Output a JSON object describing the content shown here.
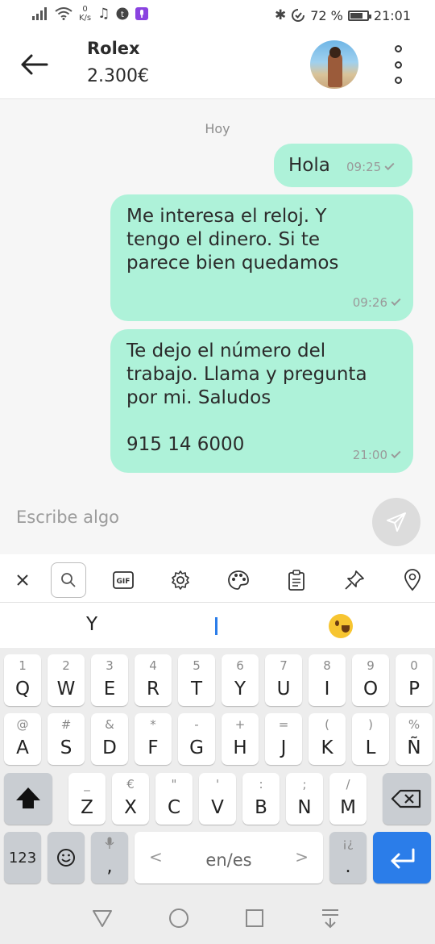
{
  "status_bar": {
    "speed_value": "0",
    "speed_unit": "K/s",
    "battery": "72 %",
    "time": "21:01"
  },
  "header": {
    "title": "Rolex",
    "price": "2.300€"
  },
  "chat": {
    "day_label": "Hoy",
    "messages": [
      {
        "text": "Hola",
        "time": "09:25"
      },
      {
        "text": "Me interesa el reloj. Y\ntengo el dinero. Si te\nparece bien quedamos",
        "time": "09:26"
      },
      {
        "text": "Te dejo el número del\ntrabajo. Llama y pregunta\npor mi. Saludos\n\n915 14 6000",
        "time": "21:00"
      }
    ]
  },
  "input": {
    "placeholder": "Escribe algo"
  },
  "keyboard": {
    "toolbar_gif": "GIF",
    "suggestion": "Y",
    "row1": [
      {
        "main": "Q",
        "sub": "1"
      },
      {
        "main": "W",
        "sub": "2"
      },
      {
        "main": "E",
        "sub": "3"
      },
      {
        "main": "R",
        "sub": "4"
      },
      {
        "main": "T",
        "sub": "5"
      },
      {
        "main": "Y",
        "sub": "6"
      },
      {
        "main": "U",
        "sub": "7"
      },
      {
        "main": "I",
        "sub": "8"
      },
      {
        "main": "O",
        "sub": "9"
      },
      {
        "main": "P",
        "sub": "0"
      }
    ],
    "row2": [
      {
        "main": "A",
        "sub": "@"
      },
      {
        "main": "S",
        "sub": "#"
      },
      {
        "main": "D",
        "sub": "&"
      },
      {
        "main": "F",
        "sub": "*"
      },
      {
        "main": "G",
        "sub": "-"
      },
      {
        "main": "H",
        "sub": "+"
      },
      {
        "main": "J",
        "sub": "="
      },
      {
        "main": "K",
        "sub": "("
      },
      {
        "main": "L",
        "sub": ")"
      },
      {
        "main": "Ñ",
        "sub": "%"
      }
    ],
    "row3": [
      {
        "main": "Z",
        "sub": "_"
      },
      {
        "main": "X",
        "sub": "€"
      },
      {
        "main": "C",
        "sub": "\""
      },
      {
        "main": "V",
        "sub": "'"
      },
      {
        "main": "B",
        "sub": ":"
      },
      {
        "main": "N",
        "sub": ";"
      },
      {
        "main": "M",
        "sub": "/"
      }
    ],
    "numbers_key": "123",
    "comma_key": ",",
    "space_label": "en/es",
    "space_left": "<",
    "space_right": ">",
    "period_key": ".",
    "period_sub": "¡¿"
  }
}
